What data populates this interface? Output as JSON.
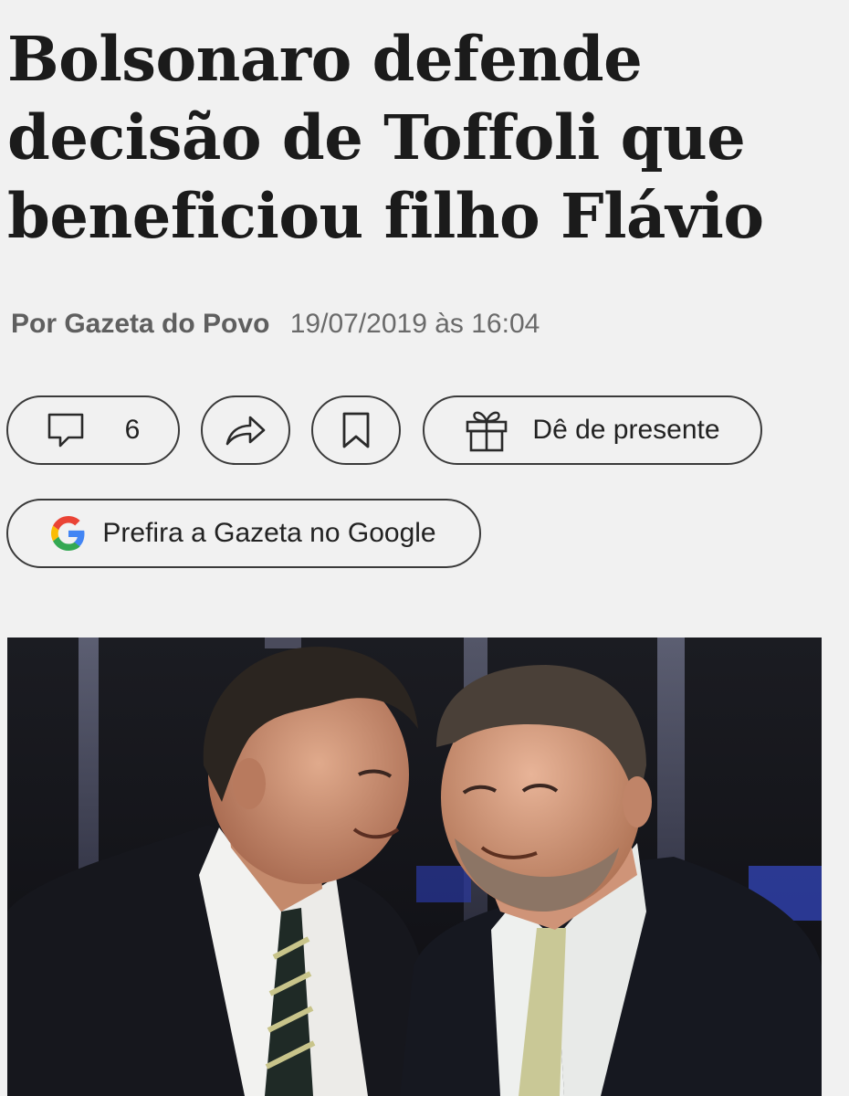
{
  "article": {
    "headline": "Bolsonaro defende decisão de Toffoli que beneficiou filho Flávio",
    "author": "Por Gazeta do Povo",
    "date": "19/07/2019 às 16:04"
  },
  "actions": {
    "comment_count": "6",
    "gift_label": "Dê de presente",
    "google_label": "Prefira a Gazeta no Google"
  },
  "icons": {
    "comment": "speech-bubble-icon",
    "share": "share-arrow-icon",
    "bookmark": "bookmark-icon",
    "gift": "gift-icon",
    "google": "google-logo-icon"
  },
  "colors": {
    "background": "#f1f1f1",
    "google_blue": "#4285F4",
    "google_red": "#EA4335",
    "google_yellow": "#FBBC05",
    "google_green": "#34A853"
  }
}
